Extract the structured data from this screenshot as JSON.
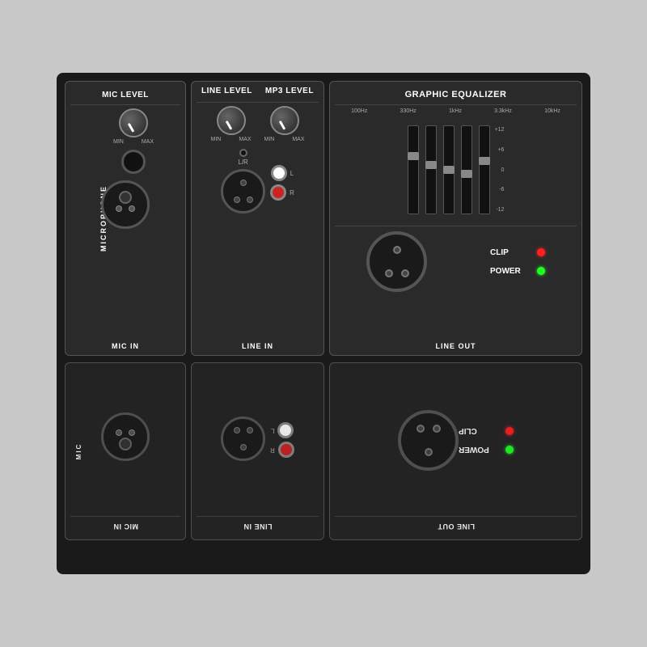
{
  "top_panel": {
    "mic_section": {
      "title": "MIC LEVEL",
      "label_vertical": "MICROPHONE",
      "knob_min": "MIN",
      "knob_max": "MAX",
      "bottom_label": "MIC IN"
    },
    "line_section": {
      "title_line": "LINE LEVEL",
      "title_mp3": "MP3 LEVEL",
      "knob_min": "MIN",
      "knob_max": "MAX",
      "lr_label": "L/R",
      "bottom_label": "LINE IN",
      "rca_l": "L",
      "rca_r": "R"
    },
    "eq_section": {
      "title": "GRAPHIC EQUALIZER",
      "freqs": [
        "100Hz",
        "330Hz",
        "1kHz",
        "3.3kHz",
        "10kHz"
      ],
      "scale": [
        "+12",
        "+6",
        "0",
        "-6",
        "-12"
      ]
    },
    "line_out_section": {
      "bottom_label": "LINE OUT",
      "clip_label": "CLIP",
      "power_label": "POWER"
    }
  },
  "bottom_panel": {
    "mic_label": "MIC IN",
    "line_in_label": "LINE IN",
    "line_out_label": "LINE OUT",
    "mic_vertical": "MIC",
    "power_label": "POWER",
    "clip_label": "CLIP"
  },
  "colors": {
    "led_red": "#ff2020",
    "led_green": "#20ff20",
    "panel_bg": "#2a2a2a",
    "border": "#555555"
  }
}
